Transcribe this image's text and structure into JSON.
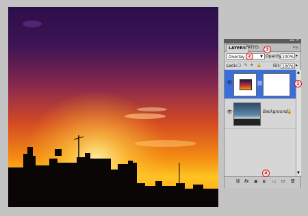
{
  "panel": {
    "tabs": [
      {
        "label": "LAYERS",
        "active": true
      },
      {
        "label": "PATHS",
        "active": false
      }
    ],
    "blend_mode": "Overlay",
    "opacity_label": "Opacity:",
    "opacity_value": "100%",
    "lock_label": "Lock:",
    "fill_label": "Fill:",
    "fill_value": "100%",
    "layers": [
      {
        "name": "",
        "selected": true,
        "type": "adjustment"
      },
      {
        "name": "Background",
        "selected": false,
        "locked": true
      }
    ],
    "icons": [
      "link-icon",
      "fx-icon",
      "mask-icon",
      "adjustment-icon",
      "group-icon",
      "new-layer-icon",
      "trash-icon"
    ]
  },
  "badges": [
    "1",
    "2",
    "3",
    "4"
  ],
  "colors": {
    "selected_layer": "#3a6ed8",
    "badge": "#dd1111"
  }
}
